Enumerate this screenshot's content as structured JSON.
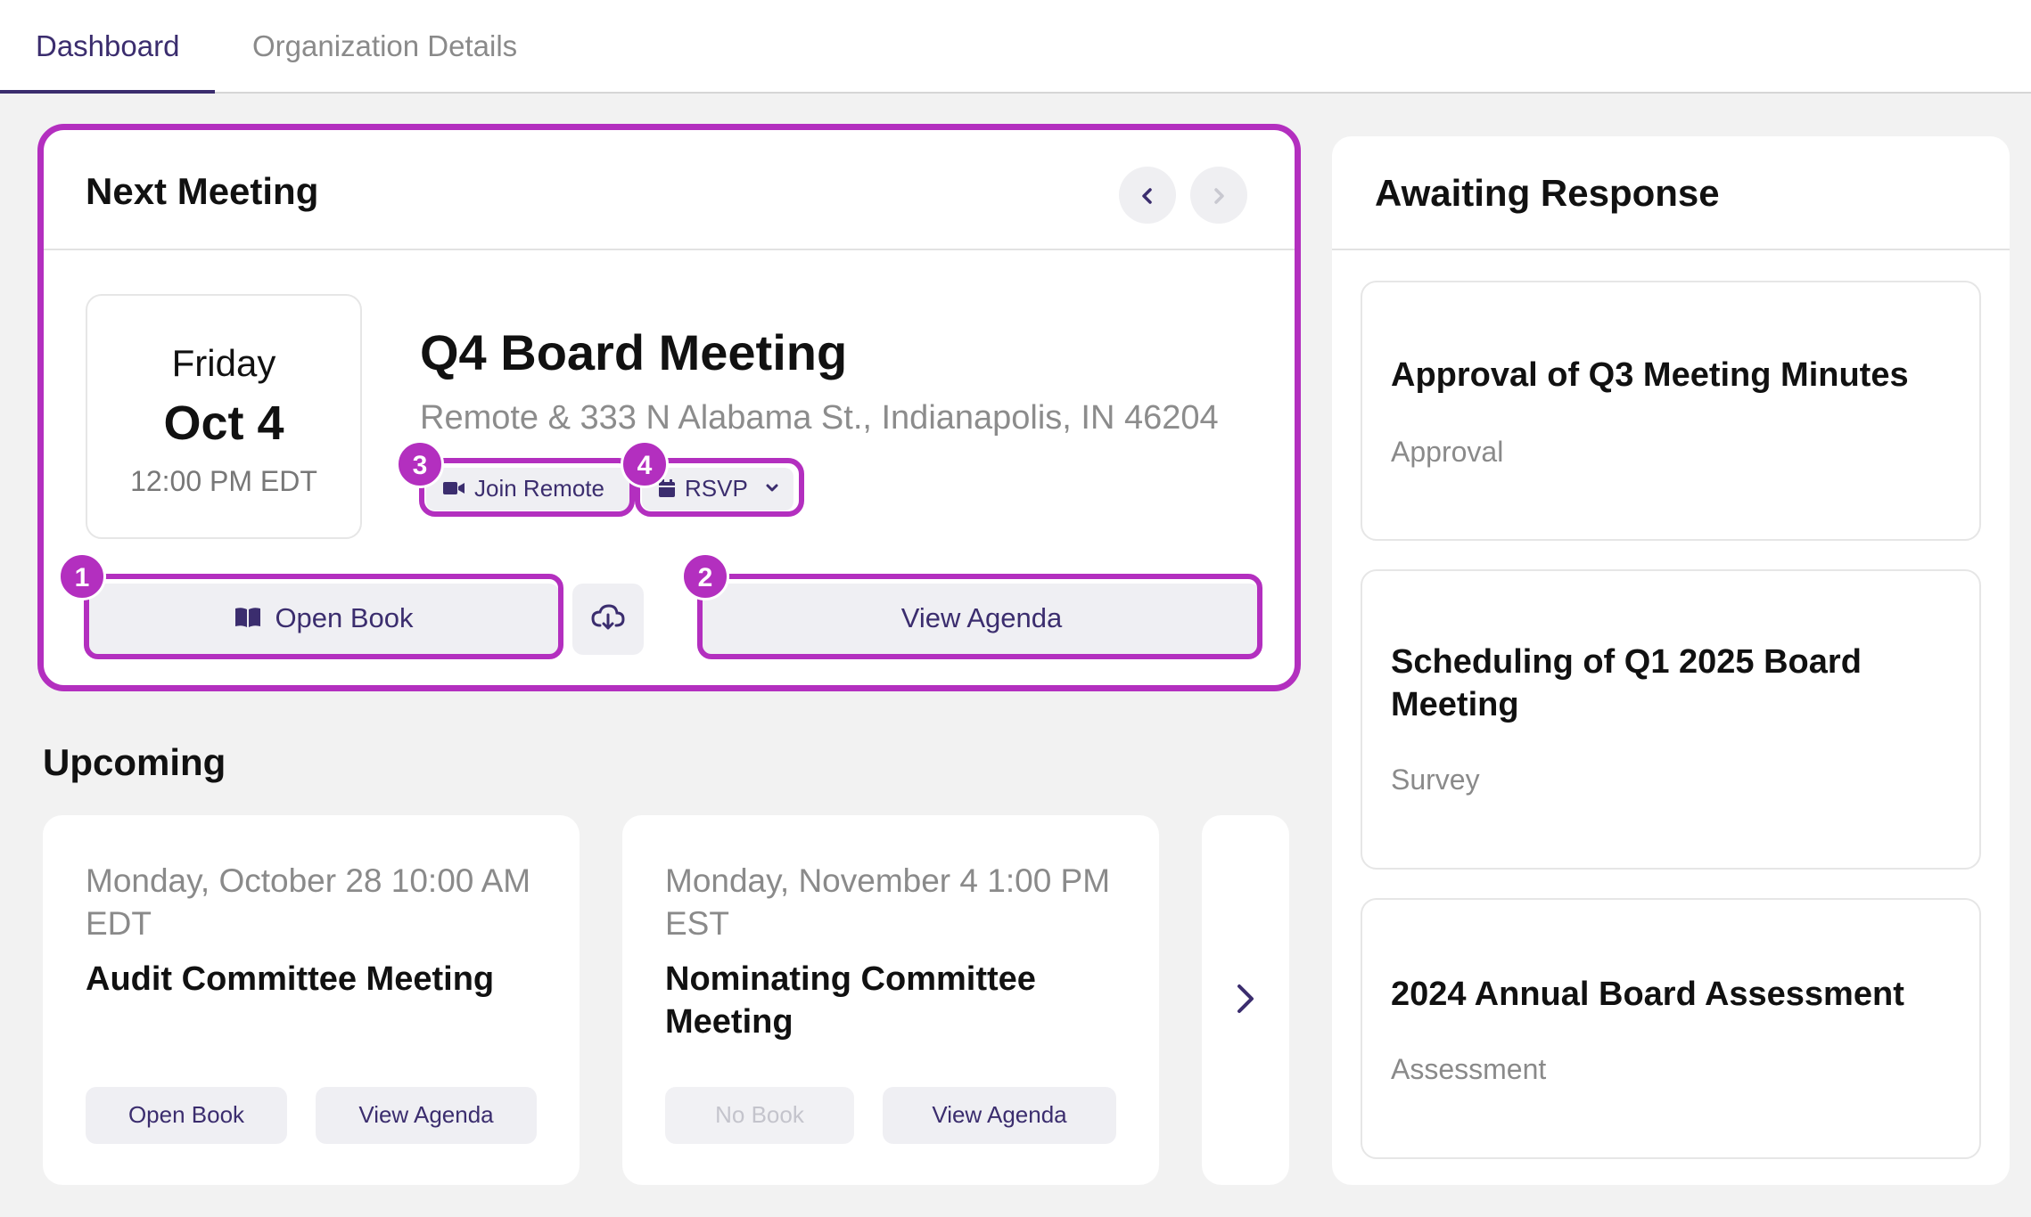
{
  "tabs": [
    {
      "label": "Dashboard",
      "active": true
    },
    {
      "label": "Organization Details",
      "active": false
    }
  ],
  "next_meeting": {
    "section_title": "Next Meeting",
    "day": "Friday",
    "date": "Oct 4",
    "time": "12:00 PM EDT",
    "title": "Q4 Board Meeting",
    "location": "Remote & 333 N Alabama St., Indianapolis, IN 46204",
    "join_label": "Join Remote",
    "rsvp_label": "RSVP",
    "open_book_label": "Open Book",
    "view_agenda_label": "View Agenda"
  },
  "badges": [
    "1",
    "2",
    "3",
    "4"
  ],
  "upcoming": {
    "section_title": "Upcoming",
    "items": [
      {
        "date": "Monday, October 28 10:00 AM EDT",
        "name": "Audit Committee Meeting",
        "book_label": "Open Book",
        "agenda_label": "View Agenda",
        "book_enabled": true
      },
      {
        "date": "Monday, November 4 1:00 PM EST",
        "name": "Nominating Committee Meeting",
        "book_label": "No Book",
        "agenda_label": "View Agenda",
        "book_enabled": false
      }
    ]
  },
  "awaiting": {
    "section_title": "Awaiting Response",
    "items": [
      {
        "name": "Approval of Q3 Meeting Minutes",
        "type": "Approval"
      },
      {
        "name": "Scheduling of Q1 2025 Board Meeting",
        "type": "Survey"
      },
      {
        "name": "2024 Annual Board Assessment",
        "type": "Assessment"
      }
    ]
  },
  "icons": {
    "prev": "chevron-left-icon",
    "next": "chevron-right-icon",
    "video": "video-camera-icon",
    "calendar": "calendar-icon",
    "book": "book-open-icon",
    "download": "cloud-download-icon"
  },
  "colors": {
    "accent": "#3b2d6e",
    "highlight": "#b32fbf",
    "background": "#f2f2f2"
  }
}
